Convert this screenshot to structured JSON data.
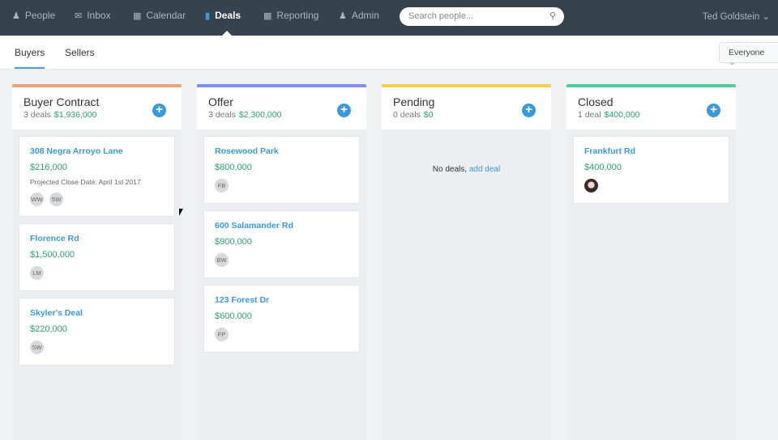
{
  "nav": {
    "items": [
      {
        "label": "People",
        "icon": "people-icon"
      },
      {
        "label": "Inbox",
        "icon": "inbox-icon"
      },
      {
        "label": "Calendar",
        "icon": "calendar-icon"
      },
      {
        "label": "Deals",
        "icon": "deals-bag-icon",
        "active": true
      },
      {
        "label": "Reporting",
        "icon": "chart-icon"
      },
      {
        "label": "Admin",
        "icon": "user-icon"
      }
    ],
    "search_placeholder": "Search people...",
    "user": "Ted Goldstein"
  },
  "subnav": {
    "tabs": [
      {
        "label": "Buyers",
        "active": true
      },
      {
        "label": "Sellers"
      }
    ],
    "filter": "Everyone"
  },
  "colors": {
    "nav": "#36434f",
    "accent": "#3a9ad9",
    "money": "#2e9e6e",
    "buyer_contract": "#f0a07a",
    "offer": "#7d8ff0",
    "pending": "#f5cf4a",
    "closed": "#4ccf9a"
  },
  "columns": [
    {
      "title": "Buyer Contract",
      "count": "3 deals",
      "total": "$1,936,000",
      "cards": [
        {
          "name": "308 Negra Arroyo Lane",
          "price": "$216,000",
          "note": "Projected Close Date: April 1st 2017",
          "avatars": [
            "WW",
            "SW"
          ]
        },
        {
          "name": "Florence Rd",
          "price": "$1,500,000",
          "avatars": [
            "LM"
          ]
        },
        {
          "name": "Skyler's Deal",
          "price": "$220,000",
          "avatars": [
            "SW"
          ]
        }
      ]
    },
    {
      "title": "Offer",
      "count": "3 deals",
      "total": "$2,300,000",
      "cards": [
        {
          "name": "Rosewood Park",
          "price": "$800,000",
          "avatars": [
            "FB"
          ]
        },
        {
          "name": "600 Salamander Rd",
          "price": "$900,000",
          "avatars": [
            "BW"
          ]
        },
        {
          "name": "123 Forest Dr",
          "price": "$600,000",
          "avatars": [
            "FP"
          ]
        }
      ]
    },
    {
      "title": "Pending",
      "count": "0 deals",
      "total": "$0",
      "empty_text": "No deals,",
      "empty_link": "add deal"
    },
    {
      "title": "Closed",
      "count": "1 deal",
      "total": "$400,000",
      "cards": [
        {
          "name": "Frankfurt Rd",
          "price": "$400,000"
        }
      ]
    }
  ]
}
